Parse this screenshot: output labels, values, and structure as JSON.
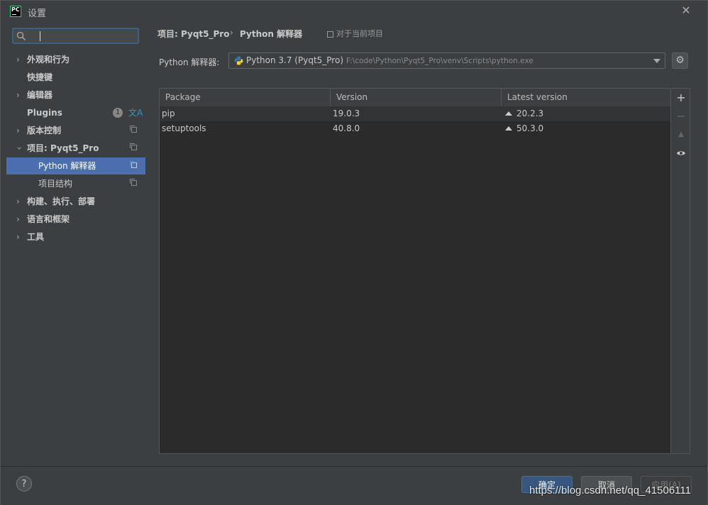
{
  "window": {
    "title": "设置",
    "app_icon_text": "PC"
  },
  "search": {
    "placeholder": ""
  },
  "sidebar": {
    "items": [
      {
        "label": "外观和行为",
        "expandable": true
      },
      {
        "label": "快捷键",
        "expandable": false
      },
      {
        "label": "编辑器",
        "expandable": true
      },
      {
        "label": "Plugins",
        "expandable": false,
        "badge": "1"
      },
      {
        "label": "版本控制",
        "expandable": true
      },
      {
        "label": "项目: Pyqt5_Pro",
        "expandable": true,
        "expanded": true
      },
      {
        "label": "Python 解释器",
        "selected": true
      },
      {
        "label": "项目结构"
      },
      {
        "label": "构建、执行、部署",
        "expandable": true
      },
      {
        "label": "语言和框架",
        "expandable": true
      },
      {
        "label": "工具",
        "expandable": true
      }
    ]
  },
  "breadcrumb": {
    "project": "项目: Pyqt5_Pro",
    "separator": "›",
    "page": "Python 解释器",
    "note": "对于当前项目"
  },
  "interpreter": {
    "label": "Python 解释器:",
    "name": "Python 3.7 (Pyqt5_Pro)",
    "path": "F:\\code\\Python\\Pyqt5_Pro\\venv\\Scripts\\python.exe"
  },
  "table": {
    "headers": [
      "Package",
      "Version",
      "Latest version"
    ],
    "rows": [
      {
        "package": "pip",
        "version": "19.0.3",
        "latest": "20.2.3"
      },
      {
        "package": "setuptools",
        "version": "40.8.0",
        "latest": "50.3.0"
      }
    ]
  },
  "footer": {
    "help": "?",
    "ok": "确定",
    "cancel": "取消",
    "apply": "应用(A)"
  },
  "watermark": "https://blog.csdn.net/qq_41506111",
  "colors": {
    "selection": "#4b6eaf",
    "background": "#3c3f41",
    "table_bg": "#2b2b2b",
    "ok_button": "#365880"
  }
}
